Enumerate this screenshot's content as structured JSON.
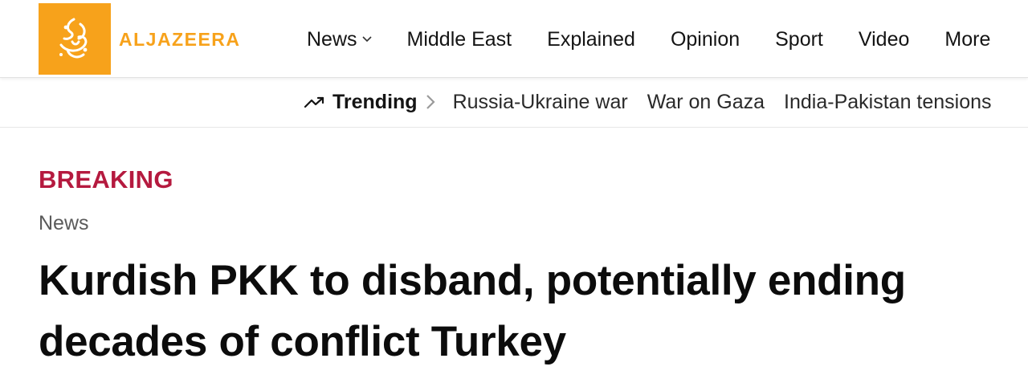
{
  "brand": {
    "logo_icon": "aljazeera-calligraphy-logo",
    "wordmark": "ALJAZEERA",
    "accent_color": "#f7a21b"
  },
  "nav": {
    "items": [
      {
        "label": "News",
        "has_dropdown": true
      },
      {
        "label": "Middle East"
      },
      {
        "label": "Explained"
      },
      {
        "label": "Opinion"
      },
      {
        "label": "Sport"
      },
      {
        "label": "Video"
      },
      {
        "label": "More"
      }
    ]
  },
  "trending": {
    "label": "Trending",
    "icon": "trending-up-icon",
    "links": [
      "Russia-Ukraine war",
      "War on Gaza",
      "India-Pakistan tensions"
    ]
  },
  "article": {
    "flag": "BREAKING",
    "flag_color": "#b51a3f",
    "category": "News",
    "headline": "Kurdish PKK to disband, potentially ending decades of conflict Turkey"
  }
}
